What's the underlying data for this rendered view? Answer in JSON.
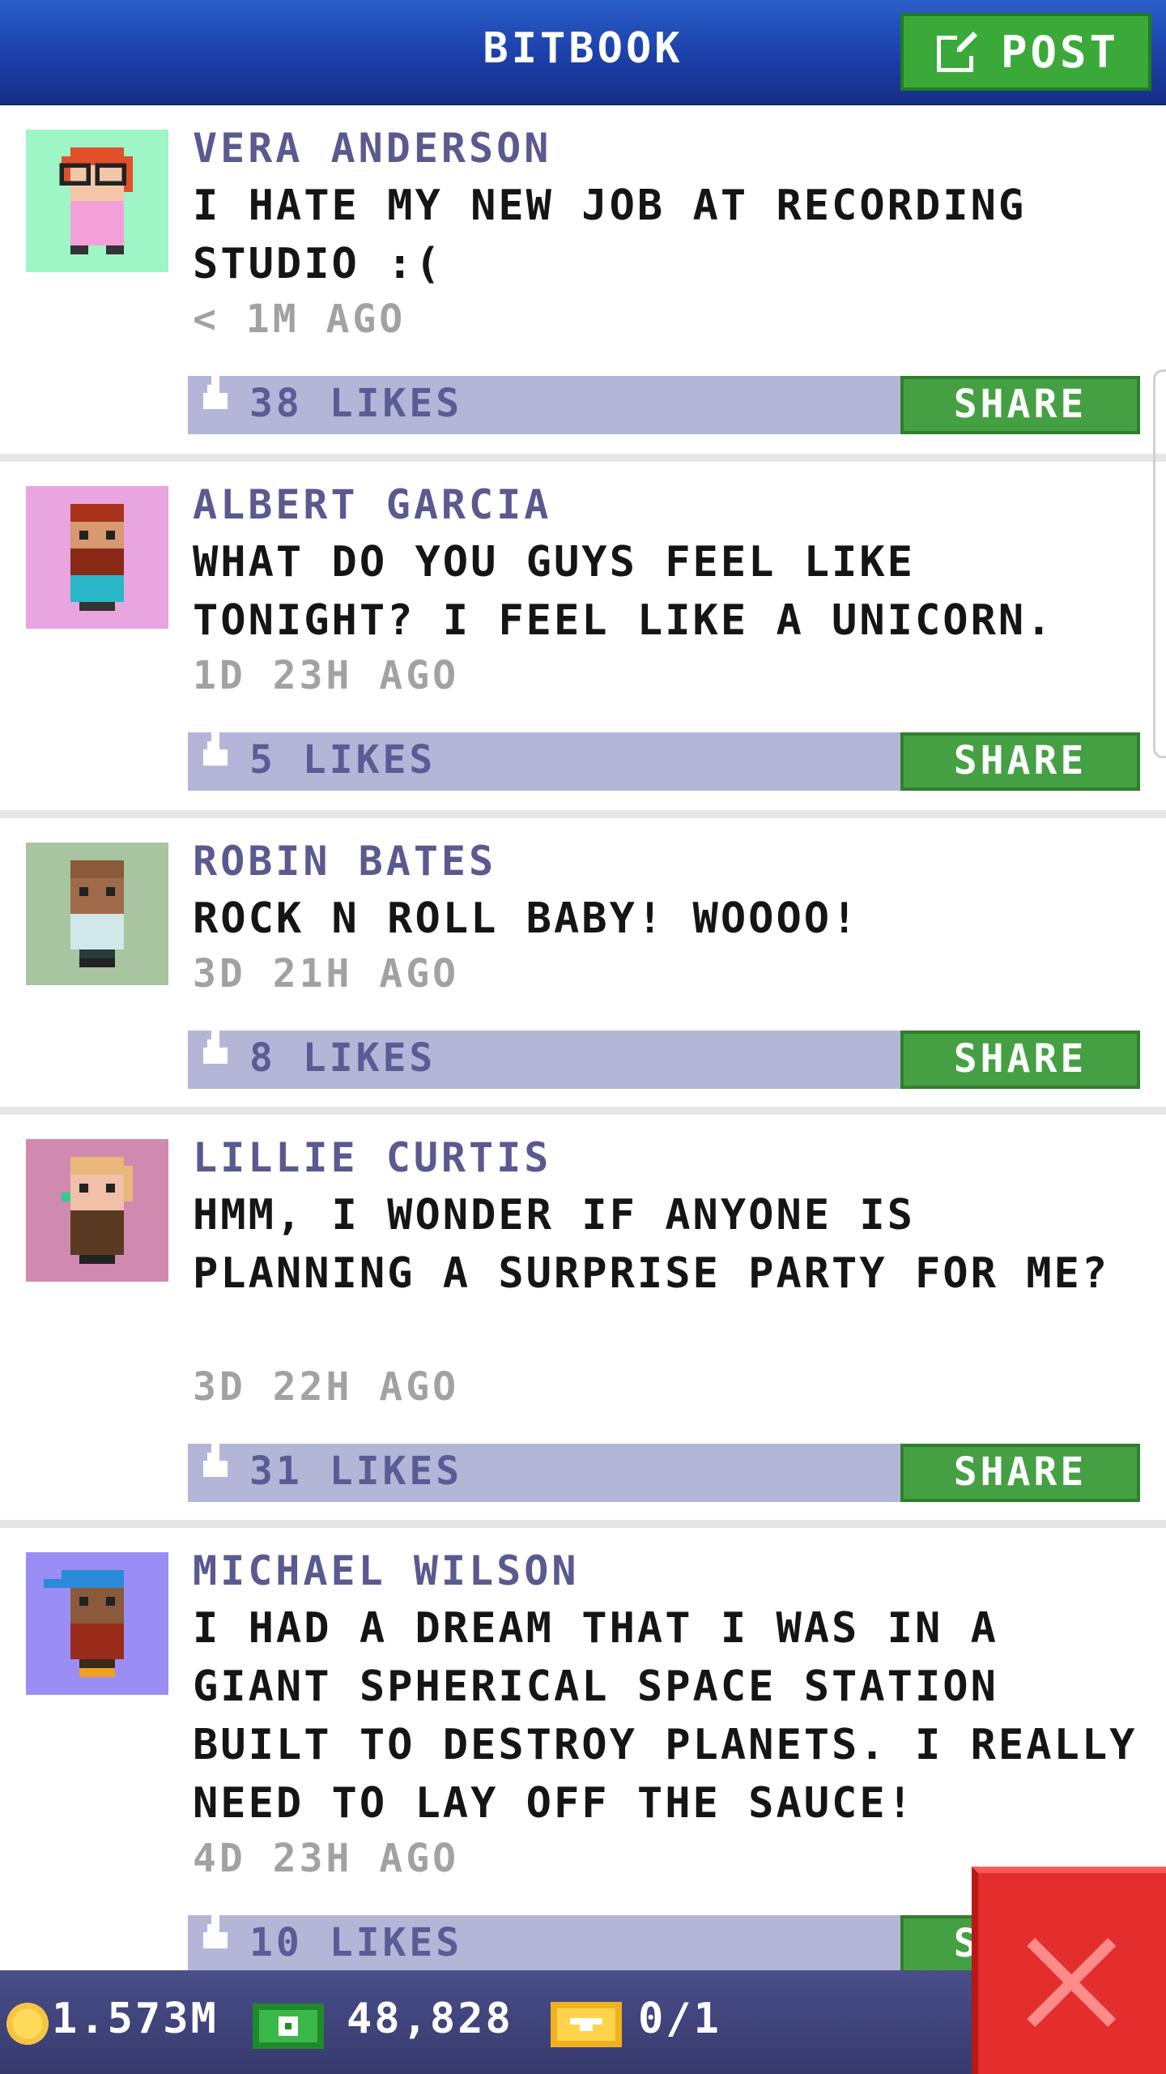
{
  "header": {
    "title": "BITBOOK",
    "post_label": "POST"
  },
  "colors": {
    "header_blue": "#1c3fa8",
    "share_green": "#45a043",
    "likes_bar": "#b4b6d8",
    "close_red": "#e42d2d"
  },
  "posts": [
    {
      "name": "VERA ANDERSON",
      "message": "I HATE MY NEW JOB AT RECORDING STUDIO :(",
      "time": "< 1M AGO",
      "likes": "38 LIKES",
      "share": "SHARE",
      "avatar_bg": "#9ef5c6"
    },
    {
      "name": "ALBERT GARCIA",
      "message": "WHAT DO YOU GUYS FEEL LIKE TONIGHT? I FEEL LIKE A UNICORN.",
      "time": "1D 23H AGO",
      "likes": "5 LIKES",
      "share": "SHARE",
      "avatar_bg": "#e8a5e0"
    },
    {
      "name": "ROBIN BATES",
      "message": "ROCK N ROLL BABY! WOOOO!",
      "time": "3D 21H AGO",
      "likes": "8 LIKES",
      "share": "SHARE",
      "avatar_bg": "#a8c4a0"
    },
    {
      "name": "LILLIE CURTIS",
      "message": "HMM, I WONDER IF ANYONE IS PLANNING A SURPRISE PARTY FOR ME?",
      "time": "3D 22H AGO",
      "likes": "31 LIKES",
      "share": "SHARE",
      "avatar_bg": "#d08ab0"
    },
    {
      "name": "MICHAEL WILSON",
      "message": "I HAD A DREAM THAT I WAS IN A GIANT SPHERICAL SPACE STATION BUILT TO DESTROY PLANETS. I REALLY NEED TO LAY OFF THE SAUCE!",
      "time": "4D 23H AGO",
      "likes": "10 LIKES",
      "share": "SHARE",
      "avatar_bg": "#9a8ef5"
    }
  ],
  "resources": {
    "coins": "1.573M",
    "bux": "48,828",
    "tickets": "0/1"
  },
  "icons": {
    "post": "edit-icon",
    "like": "thumbs-up-icon",
    "coin": "coin-icon",
    "bux": "bux-icon",
    "ticket": "ticket-icon",
    "close": "close-icon"
  }
}
